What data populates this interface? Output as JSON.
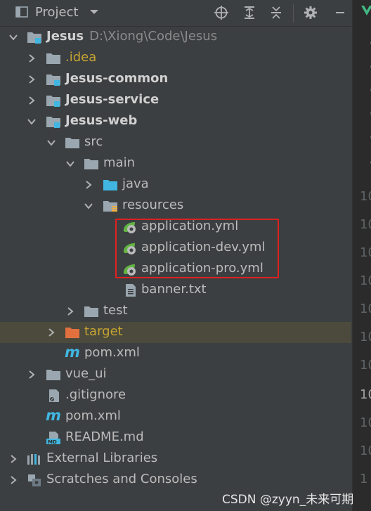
{
  "toolbar": {
    "title": "Project",
    "icons": [
      "project-window-icon",
      "chevron-down-icon",
      "locate-icon",
      "expand-all-icon",
      "collapse-all-icon",
      "gear-icon",
      "minimize-icon"
    ]
  },
  "tree": {
    "rows": [
      {
        "label": "Jesus",
        "path": "D:\\Xiong\\Code\\Jesus",
        "icon": "module-folder-icon",
        "expanded": true
      },
      {
        "label": ".idea",
        "icon": "folder-icon",
        "color": "#c5a332",
        "expanded": false
      },
      {
        "label": "Jesus-common",
        "icon": "module-folder-icon",
        "expanded": false
      },
      {
        "label": "Jesus-service",
        "icon": "module-folder-icon",
        "expanded": false
      },
      {
        "label": "Jesus-web",
        "icon": "module-folder-icon",
        "expanded": true
      },
      {
        "label": "src",
        "icon": "folder-icon",
        "expanded": true
      },
      {
        "label": "main",
        "icon": "folder-icon",
        "expanded": true
      },
      {
        "label": "java",
        "icon": "source-folder-icon",
        "expanded": false
      },
      {
        "label": "resources",
        "icon": "resources-folder-icon",
        "expanded": true
      },
      {
        "label": "application.yml",
        "icon": "spring-yml-icon"
      },
      {
        "label": "application-dev.yml",
        "icon": "spring-yml-icon"
      },
      {
        "label": "application-pro.yml",
        "icon": "spring-yml-icon"
      },
      {
        "label": "banner.txt",
        "icon": "text-file-icon"
      },
      {
        "label": "test",
        "icon": "folder-icon",
        "expanded": false
      },
      {
        "label": "target",
        "icon": "excluded-folder-icon",
        "color": "#c5a332",
        "expanded": false,
        "selected": true
      },
      {
        "label": "pom.xml",
        "icon": "maven-icon"
      },
      {
        "label": "vue_ui",
        "icon": "folder-icon",
        "expanded": false
      },
      {
        "label": ".gitignore",
        "icon": "gitignore-file-icon"
      },
      {
        "label": "pom.xml",
        "icon": "maven-icon"
      },
      {
        "label": "README.md",
        "icon": "markdown-icon"
      },
      {
        "label": "External Libraries",
        "icon": "libraries-icon",
        "expanded": false
      },
      {
        "label": "Scratches and Consoles",
        "icon": "scratches-icon",
        "expanded": false
      }
    ]
  },
  "gutter": {
    "line_numbers": [
      "10",
      "10",
      "10",
      "10",
      "10",
      "10",
      "10",
      "10",
      "10",
      "10",
      "1"
    ]
  },
  "watermark": "CSDN @zyyn_未来可期",
  "colors": {
    "background": "#3c3f41",
    "selection": "#4b4a3c",
    "excluded": "#c5a332",
    "highlight_box": "#e02020"
  }
}
